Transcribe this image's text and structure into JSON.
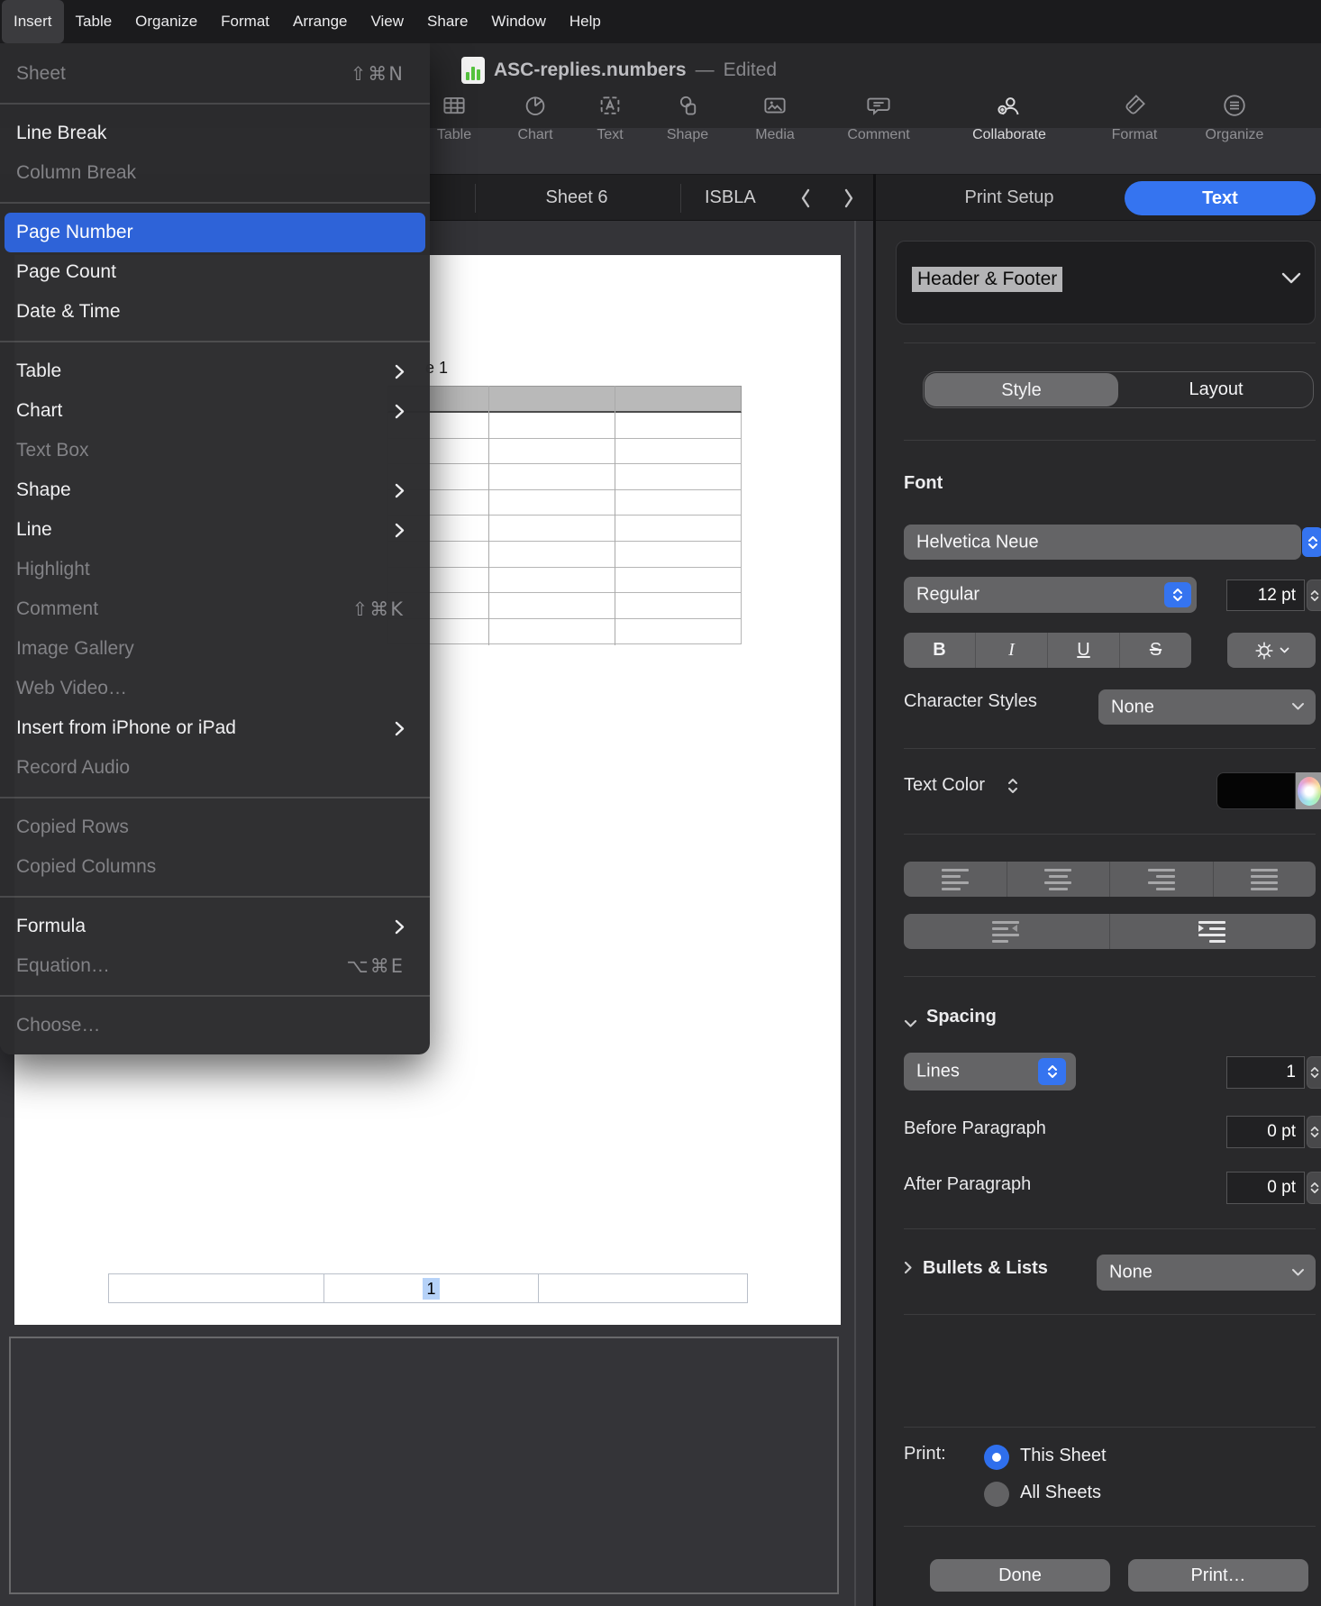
{
  "menubar": {
    "items": [
      {
        "label": "Insert",
        "active": true
      },
      {
        "label": "Table"
      },
      {
        "label": "Organize"
      },
      {
        "label": "Format"
      },
      {
        "label": "Arrange"
      },
      {
        "label": "View"
      },
      {
        "label": "Share"
      },
      {
        "label": "Window"
      },
      {
        "label": "Help"
      }
    ]
  },
  "window": {
    "title": "ASC-replies.numbers",
    "dash": "—",
    "status": "Edited"
  },
  "toolbar": {
    "items": [
      {
        "label": "Table",
        "icon": "table-icon"
      },
      {
        "label": "Chart",
        "icon": "chart-icon"
      },
      {
        "label": "Text",
        "icon": "text-icon"
      },
      {
        "label": "Shape",
        "icon": "shape-icon"
      },
      {
        "label": "Media",
        "icon": "media-icon"
      },
      {
        "label": "Comment",
        "icon": "comment-icon"
      },
      {
        "label": "Collaborate",
        "icon": "collaborate-icon",
        "emphasized": true
      },
      {
        "label": "Format",
        "icon": "format-icon"
      },
      {
        "label": "Organize",
        "icon": "organize-icon"
      }
    ]
  },
  "tabbar": {
    "sheet_tab": "Sheet 6",
    "partial_tab": "ISBLA"
  },
  "inspector_top": {
    "print_setup": "Print Setup",
    "text_button": "Text"
  },
  "insert_menu": {
    "items": [
      {
        "label": "Sheet",
        "shortcut": "⇧⌘N",
        "enabled": false
      },
      {
        "label": "Line Break",
        "enabled": true
      },
      {
        "label": "Column Break",
        "enabled": false
      },
      {
        "label": "Page Number",
        "enabled": true,
        "highlighted": true
      },
      {
        "label": "Page Count",
        "enabled": true
      },
      {
        "label": "Date & Time",
        "enabled": true
      },
      {
        "label": "Table",
        "enabled": true,
        "submenu": true
      },
      {
        "label": "Chart",
        "enabled": true,
        "submenu": true
      },
      {
        "label": "Text Box",
        "enabled": false
      },
      {
        "label": "Shape",
        "enabled": true,
        "submenu": true
      },
      {
        "label": "Line",
        "enabled": true,
        "submenu": true
      },
      {
        "label": "Highlight",
        "enabled": false
      },
      {
        "label": "Comment",
        "shortcut": "⇧⌘K",
        "enabled": false
      },
      {
        "label": "Image Gallery",
        "enabled": false
      },
      {
        "label": "Web Video…",
        "enabled": false
      },
      {
        "label": "Insert from iPhone or iPad",
        "enabled": true,
        "submenu": true
      },
      {
        "label": "Record Audio",
        "enabled": false
      },
      {
        "label": "Copied Rows",
        "enabled": false
      },
      {
        "label": "Copied Columns",
        "enabled": false
      },
      {
        "label": "Formula",
        "enabled": true,
        "submenu": true
      },
      {
        "label": "Equation…",
        "shortcut": "⌥⌘E",
        "enabled": false
      },
      {
        "label": "Choose…",
        "enabled": false
      }
    ]
  },
  "canvas": {
    "table_label_fragment": "e 1",
    "footer_page_number": "1"
  },
  "inspector": {
    "target": "Header & Footer",
    "tabs": {
      "style": "Style",
      "layout": "Layout",
      "active": "Style"
    },
    "font": {
      "section_label": "Font",
      "family": "Helvetica Neue",
      "weight": "Regular",
      "size": "12 pt",
      "bold": "B",
      "italic": "I",
      "underline": "U",
      "strikethrough": "S"
    },
    "character_styles": {
      "label": "Character Styles",
      "value": "None"
    },
    "text_color": {
      "label": "Text Color",
      "swatch_color": "#000000"
    },
    "spacing": {
      "label": "Spacing",
      "mode": "Lines",
      "value": "1",
      "before_label": "Before Paragraph",
      "before_value": "0 pt",
      "after_label": "After Paragraph",
      "after_value": "0 pt"
    },
    "bullets": {
      "label": "Bullets & Lists",
      "value": "None"
    },
    "print": {
      "label": "Print:",
      "options": [
        {
          "label": "This Sheet",
          "selected": true
        },
        {
          "label": "All Sheets",
          "selected": false
        }
      ]
    },
    "buttons": {
      "done": "Done",
      "print": "Print…"
    }
  },
  "colors": {
    "accent_blue": "#3574f0",
    "menu_highlight": "#2e63d8",
    "footer_selection": "#b6d2f8",
    "table_header_gray": "#b9b9b9"
  }
}
